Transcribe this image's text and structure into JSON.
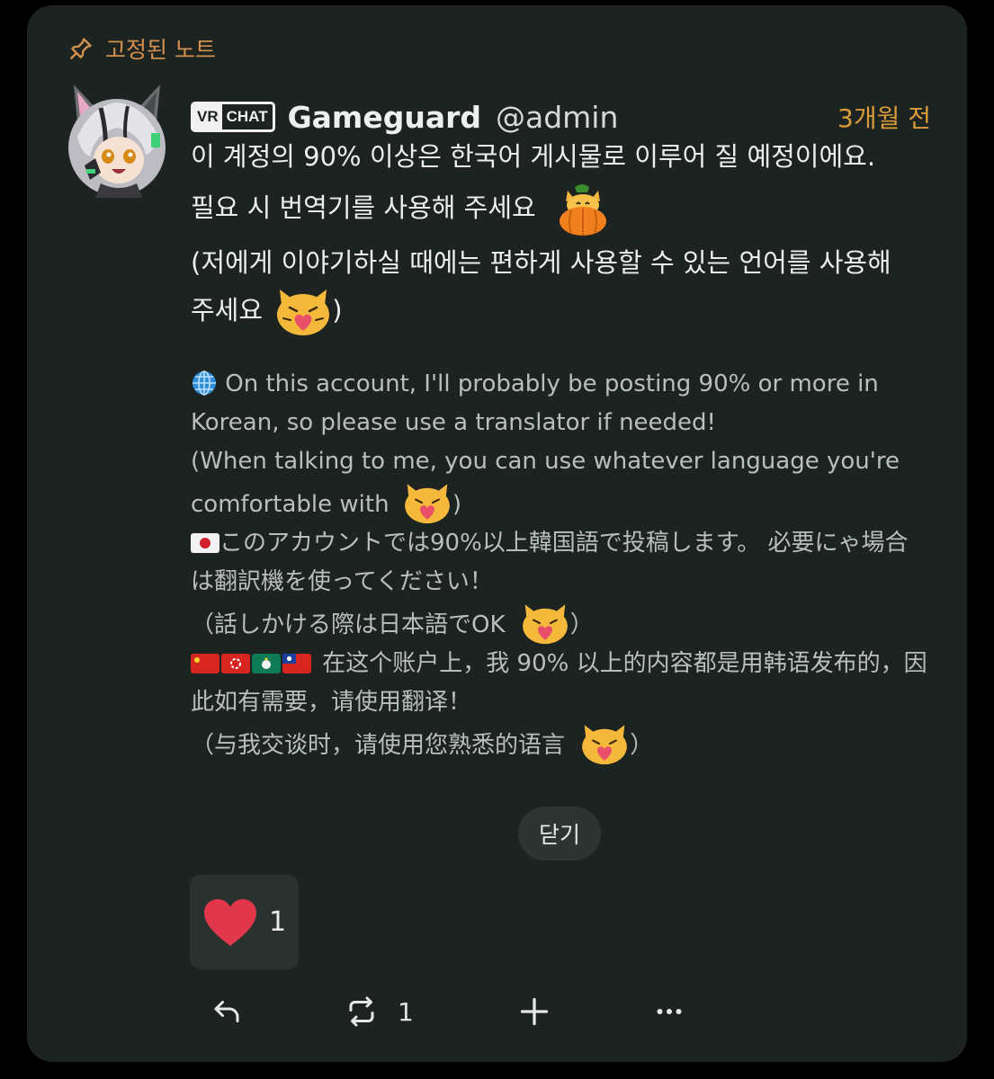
{
  "pinned": {
    "label": "고정된 노트"
  },
  "author": {
    "badge_left": "VR",
    "badge_right": "CHAT",
    "display_name": "Gameguard",
    "handle": "@admin",
    "timestamp": "3개월 전"
  },
  "korean": {
    "line1": "이 계정의 90% 이상은 한국어 게시물로 이루어 질 예정이에요.",
    "line2": "필요 시 번역기를 사용해 주세요",
    "line3": "(저에게 이야기하실 때에는 편하게 사용할 수 있는 언어를 사용해",
    "line4_a": "주세요",
    "line4_b": ")"
  },
  "english": {
    "line1": " On this account, I'll probably be posting 90% or more in",
    "line2": "Korean, so please use a translator if needed!",
    "line3": "(When talking to me, you can use whatever language you're",
    "line4_a": "comfortable with",
    "line4_b": ")"
  },
  "japanese": {
    "line1": "このアカウントでは90%以上韓国語で投稿します。 必要にゃ場合",
    "line2": "は翻訳機を使ってください！",
    "line3_a": "（話しかける際は日本語でOK",
    "line3_b": "）"
  },
  "chinese": {
    "line1": "在这个账户上，我 90% 以上的内容都是用韩语发布的，因",
    "line2": "此如有需要，请使用翻译！",
    "line3_a": "（与我交谈时，请使用您熟悉的语言",
    "line3_b": "）"
  },
  "close_button": {
    "label": "닫기"
  },
  "reaction": {
    "emoji": "heart",
    "count": "1"
  },
  "actions": {
    "renote_count": "1"
  },
  "colors": {
    "accent": "#d89c3a",
    "card": "#1d2321",
    "heart": "#e0374a"
  }
}
